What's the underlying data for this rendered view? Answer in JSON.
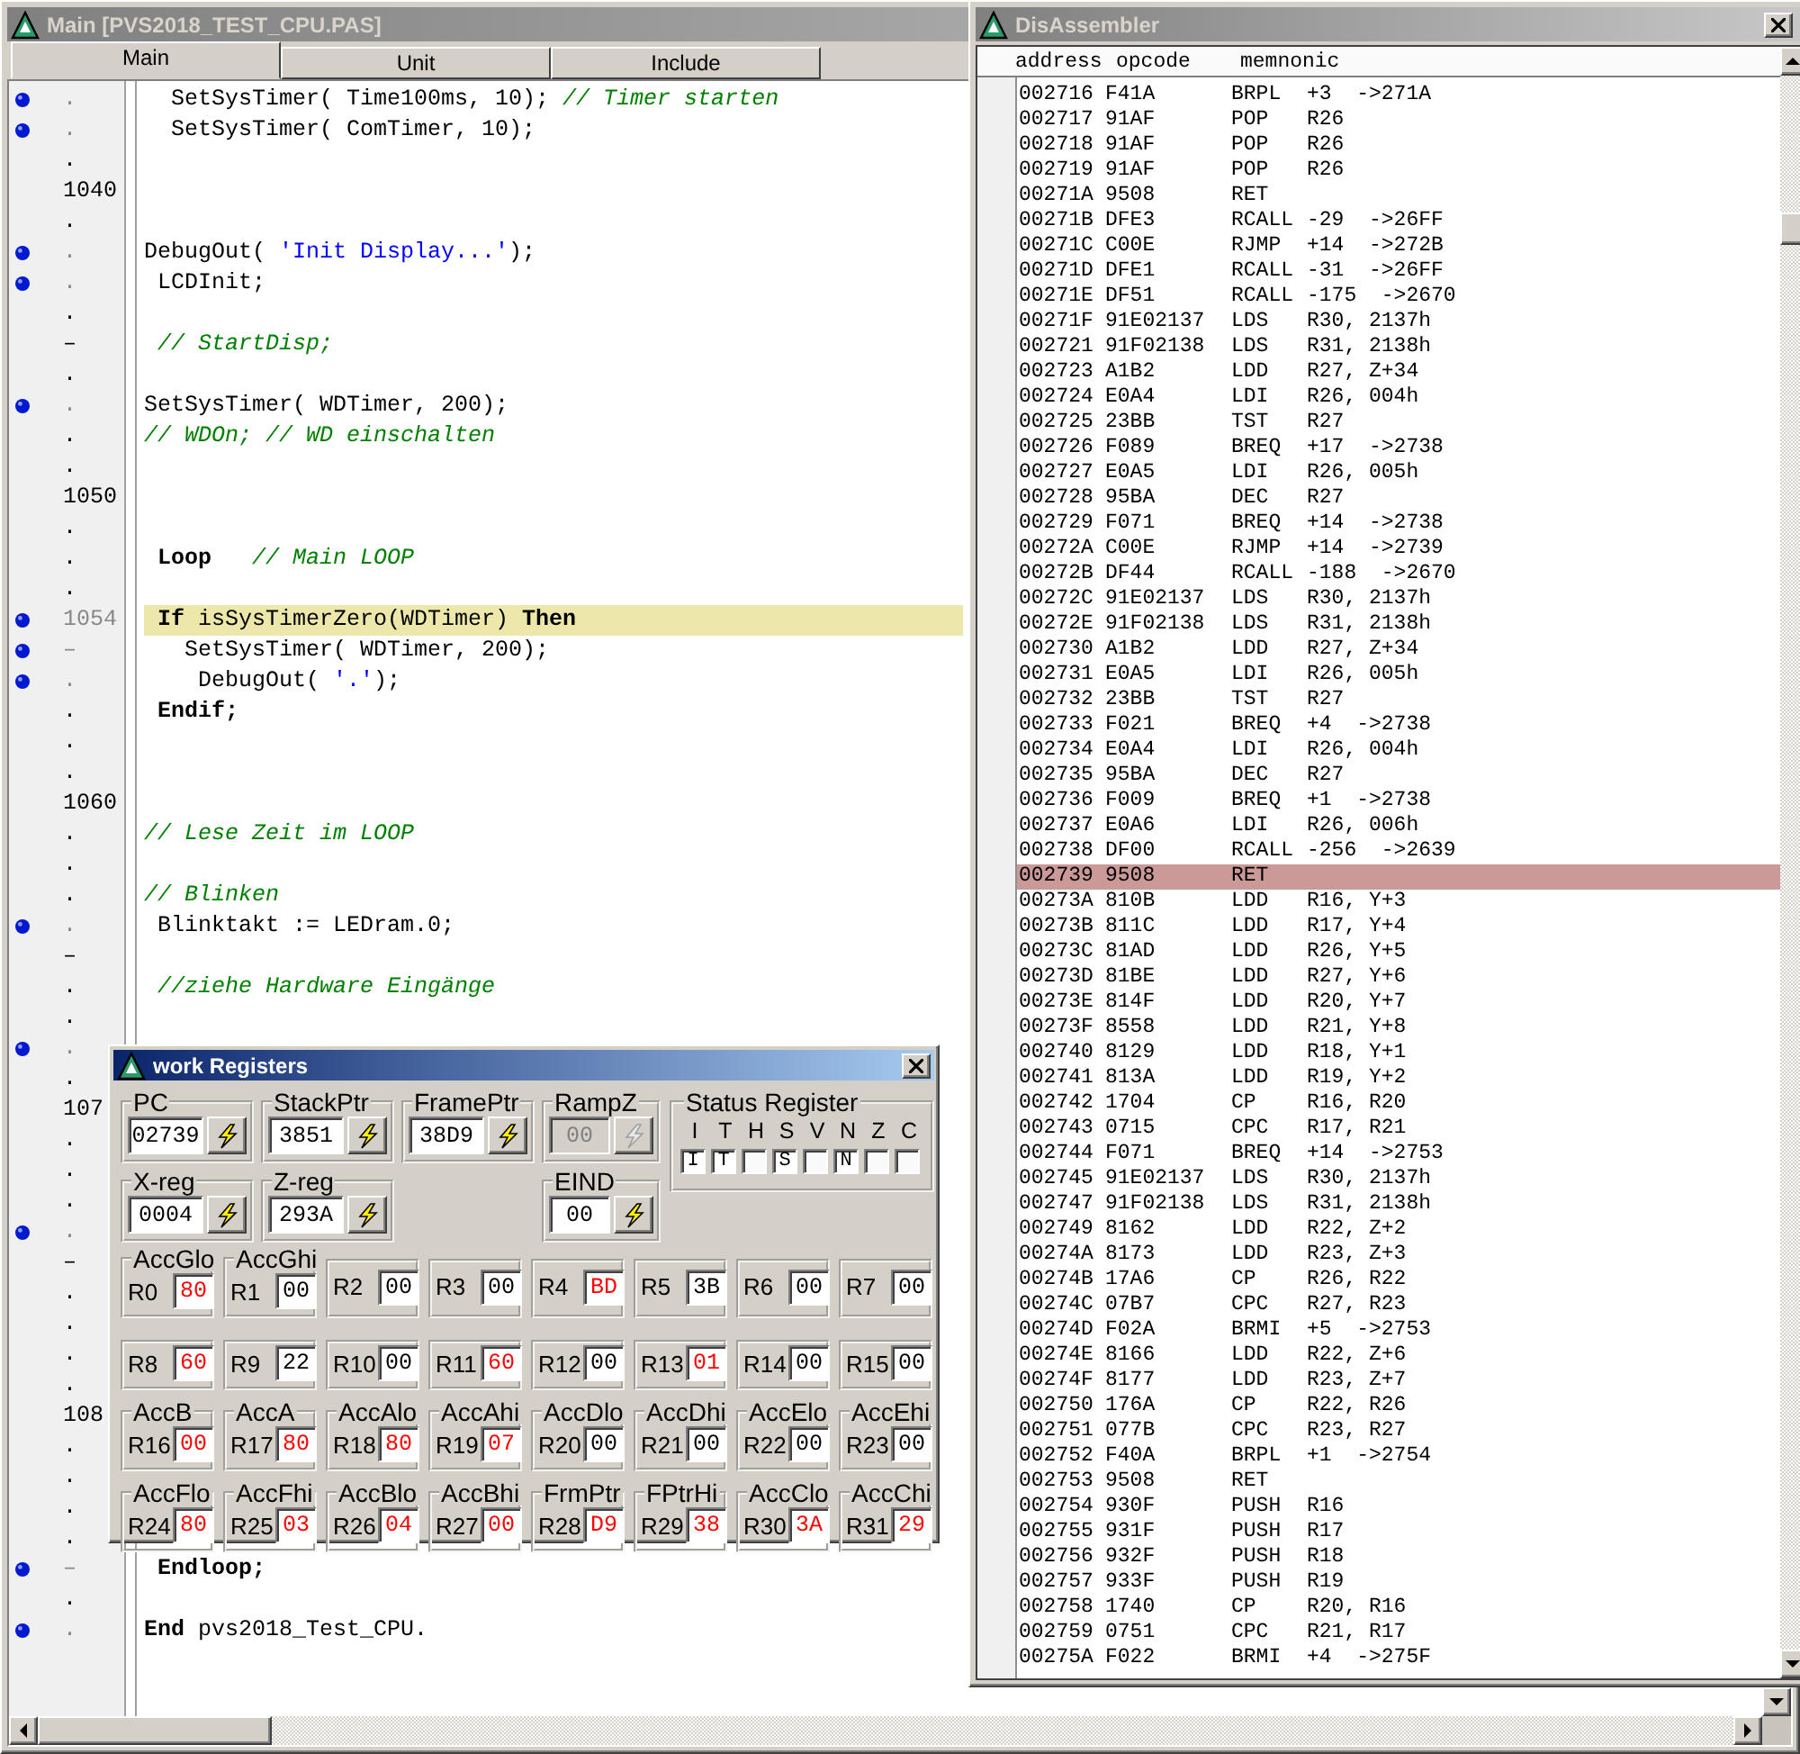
{
  "main_window": {
    "title": "Main [PVS2018_TEST_CPU.PAS]",
    "tabs": [
      {
        "label": "Main",
        "selected": true
      },
      {
        "label": "Unit",
        "selected": false
      },
      {
        "label": "Include",
        "selected": false
      }
    ],
    "lines": [
      {
        "marker": ".",
        "breakpoint": true,
        "highlighted": false,
        "segments": [
          {
            "kind": "code",
            "text": "  SetSysTimer( Time100ms, 10); "
          },
          {
            "kind": "comment",
            "text": "// Timer starten"
          }
        ]
      },
      {
        "marker": ".",
        "breakpoint": true,
        "highlighted": false,
        "segments": [
          {
            "kind": "code",
            "text": "  SetSysTimer( ComTimer, 10);"
          }
        ]
      },
      {
        "marker": ".",
        "breakpoint": false,
        "highlighted": false
      },
      {
        "marker": "1040",
        "breakpoint": false,
        "highlighted": false
      },
      {
        "marker": ".",
        "breakpoint": false,
        "highlighted": false
      },
      {
        "marker": ".",
        "breakpoint": true,
        "highlighted": false,
        "segments": [
          {
            "kind": "code",
            "text": "DebugOut( "
          },
          {
            "kind": "string",
            "text": "'Init Display...'"
          },
          {
            "kind": "code",
            "text": ");"
          }
        ]
      },
      {
        "marker": ".",
        "breakpoint": true,
        "highlighted": false,
        "segments": [
          {
            "kind": "code",
            "text": " LCDInit;"
          }
        ]
      },
      {
        "marker": ".",
        "breakpoint": false,
        "highlighted": false
      },
      {
        "marker": "–",
        "breakpoint": false,
        "highlighted": false,
        "segments": [
          {
            "kind": "comment",
            "text": " // StartDisp;"
          }
        ]
      },
      {
        "marker": ".",
        "breakpoint": false,
        "highlighted": false
      },
      {
        "marker": ".",
        "breakpoint": true,
        "highlighted": false,
        "segments": [
          {
            "kind": "code",
            "text": "SetSysTimer( WDTimer, 200);"
          }
        ]
      },
      {
        "marker": ".",
        "breakpoint": false,
        "highlighted": false,
        "segments": [
          {
            "kind": "comment",
            "text": "// WDOn; // WD einschalten"
          }
        ]
      },
      {
        "marker": ".",
        "breakpoint": false,
        "highlighted": false
      },
      {
        "marker": "1050",
        "breakpoint": false,
        "highlighted": false
      },
      {
        "marker": ".",
        "breakpoint": false,
        "highlighted": false
      },
      {
        "marker": ".",
        "breakpoint": false,
        "highlighted": false,
        "segments": [
          {
            "kind": "keyword",
            "text": " Loop"
          },
          {
            "kind": "comment",
            "text": "   // Main LOOP"
          }
        ]
      },
      {
        "marker": ".",
        "breakpoint": false,
        "highlighted": false
      },
      {
        "marker": "1054",
        "breakpoint": true,
        "highlighted": true,
        "segments": [
          {
            "kind": "keyword",
            "text": " If"
          },
          {
            "kind": "code",
            "text": " isSysTimerZero(WDTimer) "
          },
          {
            "kind": "keyword",
            "text": "Then"
          }
        ]
      },
      {
        "marker": "–",
        "breakpoint": true,
        "highlighted": false,
        "segments": [
          {
            "kind": "code",
            "text": "   SetSysTimer( WDTimer, 200);"
          }
        ]
      },
      {
        "marker": ".",
        "breakpoint": true,
        "highlighted": false,
        "segments": [
          {
            "kind": "code",
            "text": "    DebugOut( "
          },
          {
            "kind": "string",
            "text": "'.'"
          },
          {
            "kind": "code",
            "text": ");"
          }
        ]
      },
      {
        "marker": ".",
        "breakpoint": false,
        "highlighted": false,
        "segments": [
          {
            "kind": "keyword",
            "text": " Endif;"
          }
        ]
      },
      {
        "marker": ".",
        "breakpoint": false,
        "highlighted": false
      },
      {
        "marker": ".",
        "breakpoint": false,
        "highlighted": false
      },
      {
        "marker": "1060",
        "breakpoint": false,
        "highlighted": false
      },
      {
        "marker": ".",
        "breakpoint": false,
        "highlighted": false,
        "segments": [
          {
            "kind": "comment",
            "text": "// Lese Zeit im LOOP"
          }
        ]
      },
      {
        "marker": ".",
        "breakpoint": false,
        "highlighted": false
      },
      {
        "marker": ".",
        "breakpoint": false,
        "highlighted": false,
        "segments": [
          {
            "kind": "comment",
            "text": "// Blinken"
          }
        ]
      },
      {
        "marker": ".",
        "breakpoint": true,
        "highlighted": false,
        "segments": [
          {
            "kind": "code",
            "text": " Blinktakt := LEDram.0;"
          }
        ]
      },
      {
        "marker": "–",
        "breakpoint": false,
        "highlighted": false
      },
      {
        "marker": ".",
        "breakpoint": false,
        "highlighted": false,
        "segments": [
          {
            "kind": "comment",
            "text": " //ziehe Hardware Eingänge"
          }
        ]
      },
      {
        "marker": ".",
        "breakpoint": false,
        "highlighted": false
      },
      {
        "marker": ".",
        "breakpoint": true,
        "highlighted": false
      },
      {
        "marker": ".",
        "breakpoint": false,
        "highlighted": false
      },
      {
        "marker": "107",
        "breakpoint": false,
        "highlighted": false
      },
      {
        "marker": ".",
        "breakpoint": false,
        "highlighted": false
      },
      {
        "marker": ".",
        "breakpoint": false,
        "highlighted": false
      },
      {
        "marker": ".",
        "breakpoint": false,
        "highlighted": false
      },
      {
        "marker": ".",
        "breakpoint": true,
        "highlighted": false
      },
      {
        "marker": "–",
        "breakpoint": false,
        "highlighted": false
      },
      {
        "marker": ".",
        "breakpoint": false,
        "highlighted": false
      },
      {
        "marker": ".",
        "breakpoint": false,
        "highlighted": false
      },
      {
        "marker": ".",
        "breakpoint": false,
        "highlighted": false
      },
      {
        "marker": ".",
        "breakpoint": false,
        "highlighted": false
      },
      {
        "marker": "108",
        "breakpoint": false,
        "highlighted": false
      },
      {
        "marker": ".",
        "breakpoint": false,
        "highlighted": false
      },
      {
        "marker": ".",
        "breakpoint": false,
        "highlighted": false
      },
      {
        "marker": ".",
        "breakpoint": false,
        "highlighted": false
      },
      {
        "marker": ".",
        "breakpoint": false,
        "highlighted": false
      },
      {
        "marker": "–",
        "breakpoint": true,
        "highlighted": false,
        "segments": [
          {
            "kind": "keyword",
            "text": " Endloop;"
          }
        ]
      },
      {
        "marker": ".",
        "breakpoint": false,
        "highlighted": false
      },
      {
        "marker": ".",
        "breakpoint": true,
        "highlighted": false,
        "segments": [
          {
            "kind": "keyword",
            "text": "End"
          },
          {
            "kind": "code",
            "text": " pvs2018_Test_CPU."
          }
        ]
      }
    ]
  },
  "disassembler": {
    "title": "DisAssembler",
    "columns": [
      "address",
      "opcode",
      "memnonic"
    ],
    "rows": [
      {
        "address": "002716",
        "opcode": "F41A",
        "mnemonic": "BRPL",
        "operands": "+3  ->271A",
        "current": false
      },
      {
        "address": "002717",
        "opcode": "91AF",
        "mnemonic": "POP",
        "operands": "R26",
        "current": false
      },
      {
        "address": "002718",
        "opcode": "91AF",
        "mnemonic": "POP",
        "operands": "R26",
        "current": false
      },
      {
        "address": "002719",
        "opcode": "91AF",
        "mnemonic": "POP",
        "operands": "R26",
        "current": false
      },
      {
        "address": "00271A",
        "opcode": "9508",
        "mnemonic": "RET",
        "current": false
      },
      {
        "address": "00271B",
        "opcode": "DFE3",
        "mnemonic": "RCALL",
        "operands": "-29  ->26FF",
        "current": false
      },
      {
        "address": "00271C",
        "opcode": "C00E",
        "mnemonic": "RJMP",
        "operands": "+14  ->272B",
        "current": false
      },
      {
        "address": "00271D",
        "opcode": "DFE1",
        "mnemonic": "RCALL",
        "operands": "-31  ->26FF",
        "current": false
      },
      {
        "address": "00271E",
        "opcode": "DF51",
        "mnemonic": "RCALL",
        "operands": "-175  ->2670",
        "current": false
      },
      {
        "address": "00271F",
        "opcode": "91E02137",
        "mnemonic": "LDS",
        "operands": "R30, 2137h",
        "current": false
      },
      {
        "address": "002721",
        "opcode": "91F02138",
        "mnemonic": "LDS",
        "operands": "R31, 2138h",
        "current": false
      },
      {
        "address": "002723",
        "opcode": "A1B2",
        "mnemonic": "LDD",
        "operands": "R27, Z+34",
        "current": false
      },
      {
        "address": "002724",
        "opcode": "E0A4",
        "mnemonic": "LDI",
        "operands": "R26, 004h",
        "current": false
      },
      {
        "address": "002725",
        "opcode": "23BB",
        "mnemonic": "TST",
        "operands": "R27",
        "current": false
      },
      {
        "address": "002726",
        "opcode": "F089",
        "mnemonic": "BREQ",
        "operands": "+17  ->2738",
        "current": false
      },
      {
        "address": "002727",
        "opcode": "E0A5",
        "mnemonic": "LDI",
        "operands": "R26, 005h",
        "current": false
      },
      {
        "address": "002728",
        "opcode": "95BA",
        "mnemonic": "DEC",
        "operands": "R27",
        "current": false
      },
      {
        "address": "002729",
        "opcode": "F071",
        "mnemonic": "BREQ",
        "operands": "+14  ->2738",
        "current": false
      },
      {
        "address": "00272A",
        "opcode": "C00E",
        "mnemonic": "RJMP",
        "operands": "+14  ->2739",
        "current": false
      },
      {
        "address": "00272B",
        "opcode": "DF44",
        "mnemonic": "RCALL",
        "operands": "-188  ->2670",
        "current": false
      },
      {
        "address": "00272C",
        "opcode": "91E02137",
        "mnemonic": "LDS",
        "operands": "R30, 2137h",
        "current": false
      },
      {
        "address": "00272E",
        "opcode": "91F02138",
        "mnemonic": "LDS",
        "operands": "R31, 2138h",
        "current": false
      },
      {
        "address": "002730",
        "opcode": "A1B2",
        "mnemonic": "LDD",
        "operands": "R27, Z+34",
        "current": false
      },
      {
        "address": "002731",
        "opcode": "E0A5",
        "mnemonic": "LDI",
        "operands": "R26, 005h",
        "current": false
      },
      {
        "address": "002732",
        "opcode": "23BB",
        "mnemonic": "TST",
        "operands": "R27",
        "current": false
      },
      {
        "address": "002733",
        "opcode": "F021",
        "mnemonic": "BREQ",
        "operands": "+4  ->2738",
        "current": false
      },
      {
        "address": "002734",
        "opcode": "E0A4",
        "mnemonic": "LDI",
        "operands": "R26, 004h",
        "current": false
      },
      {
        "address": "002735",
        "opcode": "95BA",
        "mnemonic": "DEC",
        "operands": "R27",
        "current": false
      },
      {
        "address": "002736",
        "opcode": "F009",
        "mnemonic": "BREQ",
        "operands": "+1  ->2738",
        "current": false
      },
      {
        "address": "002737",
        "opcode": "E0A6",
        "mnemonic": "LDI",
        "operands": "R26, 006h",
        "current": false
      },
      {
        "address": "002738",
        "opcode": "DF00",
        "mnemonic": "RCALL",
        "operands": "-256  ->2639",
        "current": false
      },
      {
        "address": "002739",
        "opcode": "9508",
        "mnemonic": "RET",
        "current": true
      },
      {
        "address": "00273A",
        "opcode": "810B",
        "mnemonic": "LDD",
        "operands": "R16, Y+3",
        "current": false
      },
      {
        "address": "00273B",
        "opcode": "811C",
        "mnemonic": "LDD",
        "operands": "R17, Y+4",
        "current": false
      },
      {
        "address": "00273C",
        "opcode": "81AD",
        "mnemonic": "LDD",
        "operands": "R26, Y+5",
        "current": false
      },
      {
        "address": "00273D",
        "opcode": "81BE",
        "mnemonic": "LDD",
        "operands": "R27, Y+6",
        "current": false
      },
      {
        "address": "00273E",
        "opcode": "814F",
        "mnemonic": "LDD",
        "operands": "R20, Y+7",
        "current": false
      },
      {
        "address": "00273F",
        "opcode": "8558",
        "mnemonic": "LDD",
        "operands": "R21, Y+8",
        "current": false
      },
      {
        "address": "002740",
        "opcode": "8129",
        "mnemonic": "LDD",
        "operands": "R18, Y+1",
        "current": false
      },
      {
        "address": "002741",
        "opcode": "813A",
        "mnemonic": "LDD",
        "operands": "R19, Y+2",
        "current": false
      },
      {
        "address": "002742",
        "opcode": "1704",
        "mnemonic": "CP",
        "operands": "R16, R20",
        "current": false
      },
      {
        "address": "002743",
        "opcode": "0715",
        "mnemonic": "CPC",
        "operands": "R17, R21",
        "current": false
      },
      {
        "address": "002744",
        "opcode": "F071",
        "mnemonic": "BREQ",
        "operands": "+14  ->2753",
        "current": false
      },
      {
        "address": "002745",
        "opcode": "91E02137",
        "mnemonic": "LDS",
        "operands": "R30, 2137h",
        "current": false
      },
      {
        "address": "002747",
        "opcode": "91F02138",
        "mnemonic": "LDS",
        "operands": "R31, 2138h",
        "current": false
      },
      {
        "address": "002749",
        "opcode": "8162",
        "mnemonic": "LDD",
        "operands": "R22, Z+2",
        "current": false
      },
      {
        "address": "00274A",
        "opcode": "8173",
        "mnemonic": "LDD",
        "operands": "R23, Z+3",
        "current": false
      },
      {
        "address": "00274B",
        "opcode": "17A6",
        "mnemonic": "CP",
        "operands": "R26, R22",
        "current": false
      },
      {
        "address": "00274C",
        "opcode": "07B7",
        "mnemonic": "CPC",
        "operands": "R27, R23",
        "current": false
      },
      {
        "address": "00274D",
        "opcode": "F02A",
        "mnemonic": "BRMI",
        "operands": "+5  ->2753",
        "current": false
      },
      {
        "address": "00274E",
        "opcode": "8166",
        "mnemonic": "LDD",
        "operands": "R22, Z+6",
        "current": false
      },
      {
        "address": "00274F",
        "opcode": "8177",
        "mnemonic": "LDD",
        "operands": "R23, Z+7",
        "current": false
      },
      {
        "address": "002750",
        "opcode": "176A",
        "mnemonic": "CP",
        "operands": "R22, R26",
        "current": false
      },
      {
        "address": "002751",
        "opcode": "077B",
        "mnemonic": "CPC",
        "operands": "R23, R27",
        "current": false
      },
      {
        "address": "002752",
        "opcode": "F40A",
        "mnemonic": "BRPL",
        "operands": "+1  ->2754",
        "current": false
      },
      {
        "address": "002753",
        "opcode": "9508",
        "mnemonic": "RET",
        "current": false
      },
      {
        "address": "002754",
        "opcode": "930F",
        "mnemonic": "PUSH",
        "operands": "R16",
        "current": false
      },
      {
        "address": "002755",
        "opcode": "931F",
        "mnemonic": "PUSH",
        "operands": "R17",
        "current": false
      },
      {
        "address": "002756",
        "opcode": "932F",
        "mnemonic": "PUSH",
        "operands": "R18",
        "current": false
      },
      {
        "address": "002757",
        "opcode": "933F",
        "mnemonic": "PUSH",
        "operands": "R19",
        "current": false
      },
      {
        "address": "002758",
        "opcode": "1740",
        "mnemonic": "CP",
        "operands": "R20, R16",
        "current": false
      },
      {
        "address": "002759",
        "opcode": "0751",
        "mnemonic": "CPC",
        "operands": "R21, R17",
        "current": false
      },
      {
        "address": "00275A",
        "opcode": "F022",
        "mnemonic": "BRMI",
        "operands": "+4  ->275F",
        "current": false
      }
    ]
  },
  "registers_dialog": {
    "title": "work Registers",
    "pointer_rows": [
      [
        {
          "label": "PC",
          "value": "02739",
          "disabled": false
        },
        {
          "label": "StackPtr",
          "value": "3851",
          "disabled": false
        },
        {
          "label": "FramePtr",
          "value": "38D9",
          "disabled": false
        },
        {
          "label": "RampZ",
          "value": "00",
          "disabled": true
        }
      ],
      [
        {
          "label": "X-reg",
          "value": "0004",
          "disabled": false
        },
        {
          "label": "Z-reg",
          "value": "293A",
          "disabled": false
        },
        {
          "label": "EIND",
          "value": "00",
          "disabled": false
        }
      ]
    ],
    "status_register": {
      "title": "Status Register",
      "flags": [
        {
          "label": "I",
          "set": true,
          "box_text": "I"
        },
        {
          "label": "T",
          "set": true,
          "box_text": "T"
        },
        {
          "label": "H",
          "set": false
        },
        {
          "label": "S",
          "set": true,
          "box_text": "S"
        },
        {
          "label": "V",
          "set": false
        },
        {
          "label": "N",
          "set": true,
          "box_text": "N"
        },
        {
          "label": "Z",
          "set": false
        },
        {
          "label": "C",
          "set": false
        }
      ]
    },
    "registers": [
      {
        "alias": "AccGlo",
        "name": "R0",
        "value": "80",
        "changed": true
      },
      {
        "alias": "AccGhi",
        "name": "R1",
        "value": "00",
        "changed": false
      },
      {
        "name": "R2",
        "value": "00",
        "changed": false
      },
      {
        "name": "R3",
        "value": "00",
        "changed": false
      },
      {
        "name": "R4",
        "value": "BD",
        "changed": true
      },
      {
        "name": "R5",
        "value": "3B",
        "changed": false
      },
      {
        "name": "R6",
        "value": "00",
        "changed": false
      },
      {
        "name": "R7",
        "value": "00",
        "changed": false
      },
      {
        "name": "R8",
        "value": "60",
        "changed": true
      },
      {
        "name": "R9",
        "value": "22",
        "changed": false
      },
      {
        "name": "R10",
        "value": "00",
        "changed": false
      },
      {
        "name": "R11",
        "value": "60",
        "changed": true
      },
      {
        "name": "R12",
        "value": "00",
        "changed": false
      },
      {
        "name": "R13",
        "value": "01",
        "changed": true
      },
      {
        "name": "R14",
        "value": "00",
        "changed": false
      },
      {
        "name": "R15",
        "value": "00",
        "changed": false
      },
      {
        "alias": "AccB",
        "name": "R16",
        "value": "00",
        "changed": true
      },
      {
        "alias": "AccA",
        "name": "R17",
        "value": "80",
        "changed": true
      },
      {
        "alias": "AccAlo",
        "name": "R18",
        "value": "80",
        "changed": true
      },
      {
        "alias": "AccAhi",
        "name": "R19",
        "value": "07",
        "changed": true
      },
      {
        "alias": "AccDlo",
        "name": "R20",
        "value": "00",
        "changed": false
      },
      {
        "alias": "AccDhi",
        "name": "R21",
        "value": "00",
        "changed": false
      },
      {
        "alias": "AccElo",
        "name": "R22",
        "value": "00",
        "changed": false
      },
      {
        "alias": "AccEhi",
        "name": "R23",
        "value": "00",
        "changed": false
      },
      {
        "alias": "AccFlo",
        "name": "R24",
        "value": "80",
        "changed": true
      },
      {
        "alias": "AccFhi",
        "name": "R25",
        "value": "03",
        "changed": true
      },
      {
        "alias": "AccBlo",
        "name": "R26",
        "value": "04",
        "changed": true
      },
      {
        "alias": "AccBhi",
        "name": "R27",
        "value": "00",
        "changed": true
      },
      {
        "alias": "FrmPtr",
        "name": "R28",
        "value": "D9",
        "changed": true
      },
      {
        "alias": "FPtrHi",
        "name": "R29",
        "value": "38",
        "changed": true
      },
      {
        "alias": "AccClo",
        "name": "R30",
        "value": "3A",
        "changed": true
      },
      {
        "alias": "AccChi",
        "name": "R31",
        "value": "29",
        "changed": true
      }
    ]
  }
}
